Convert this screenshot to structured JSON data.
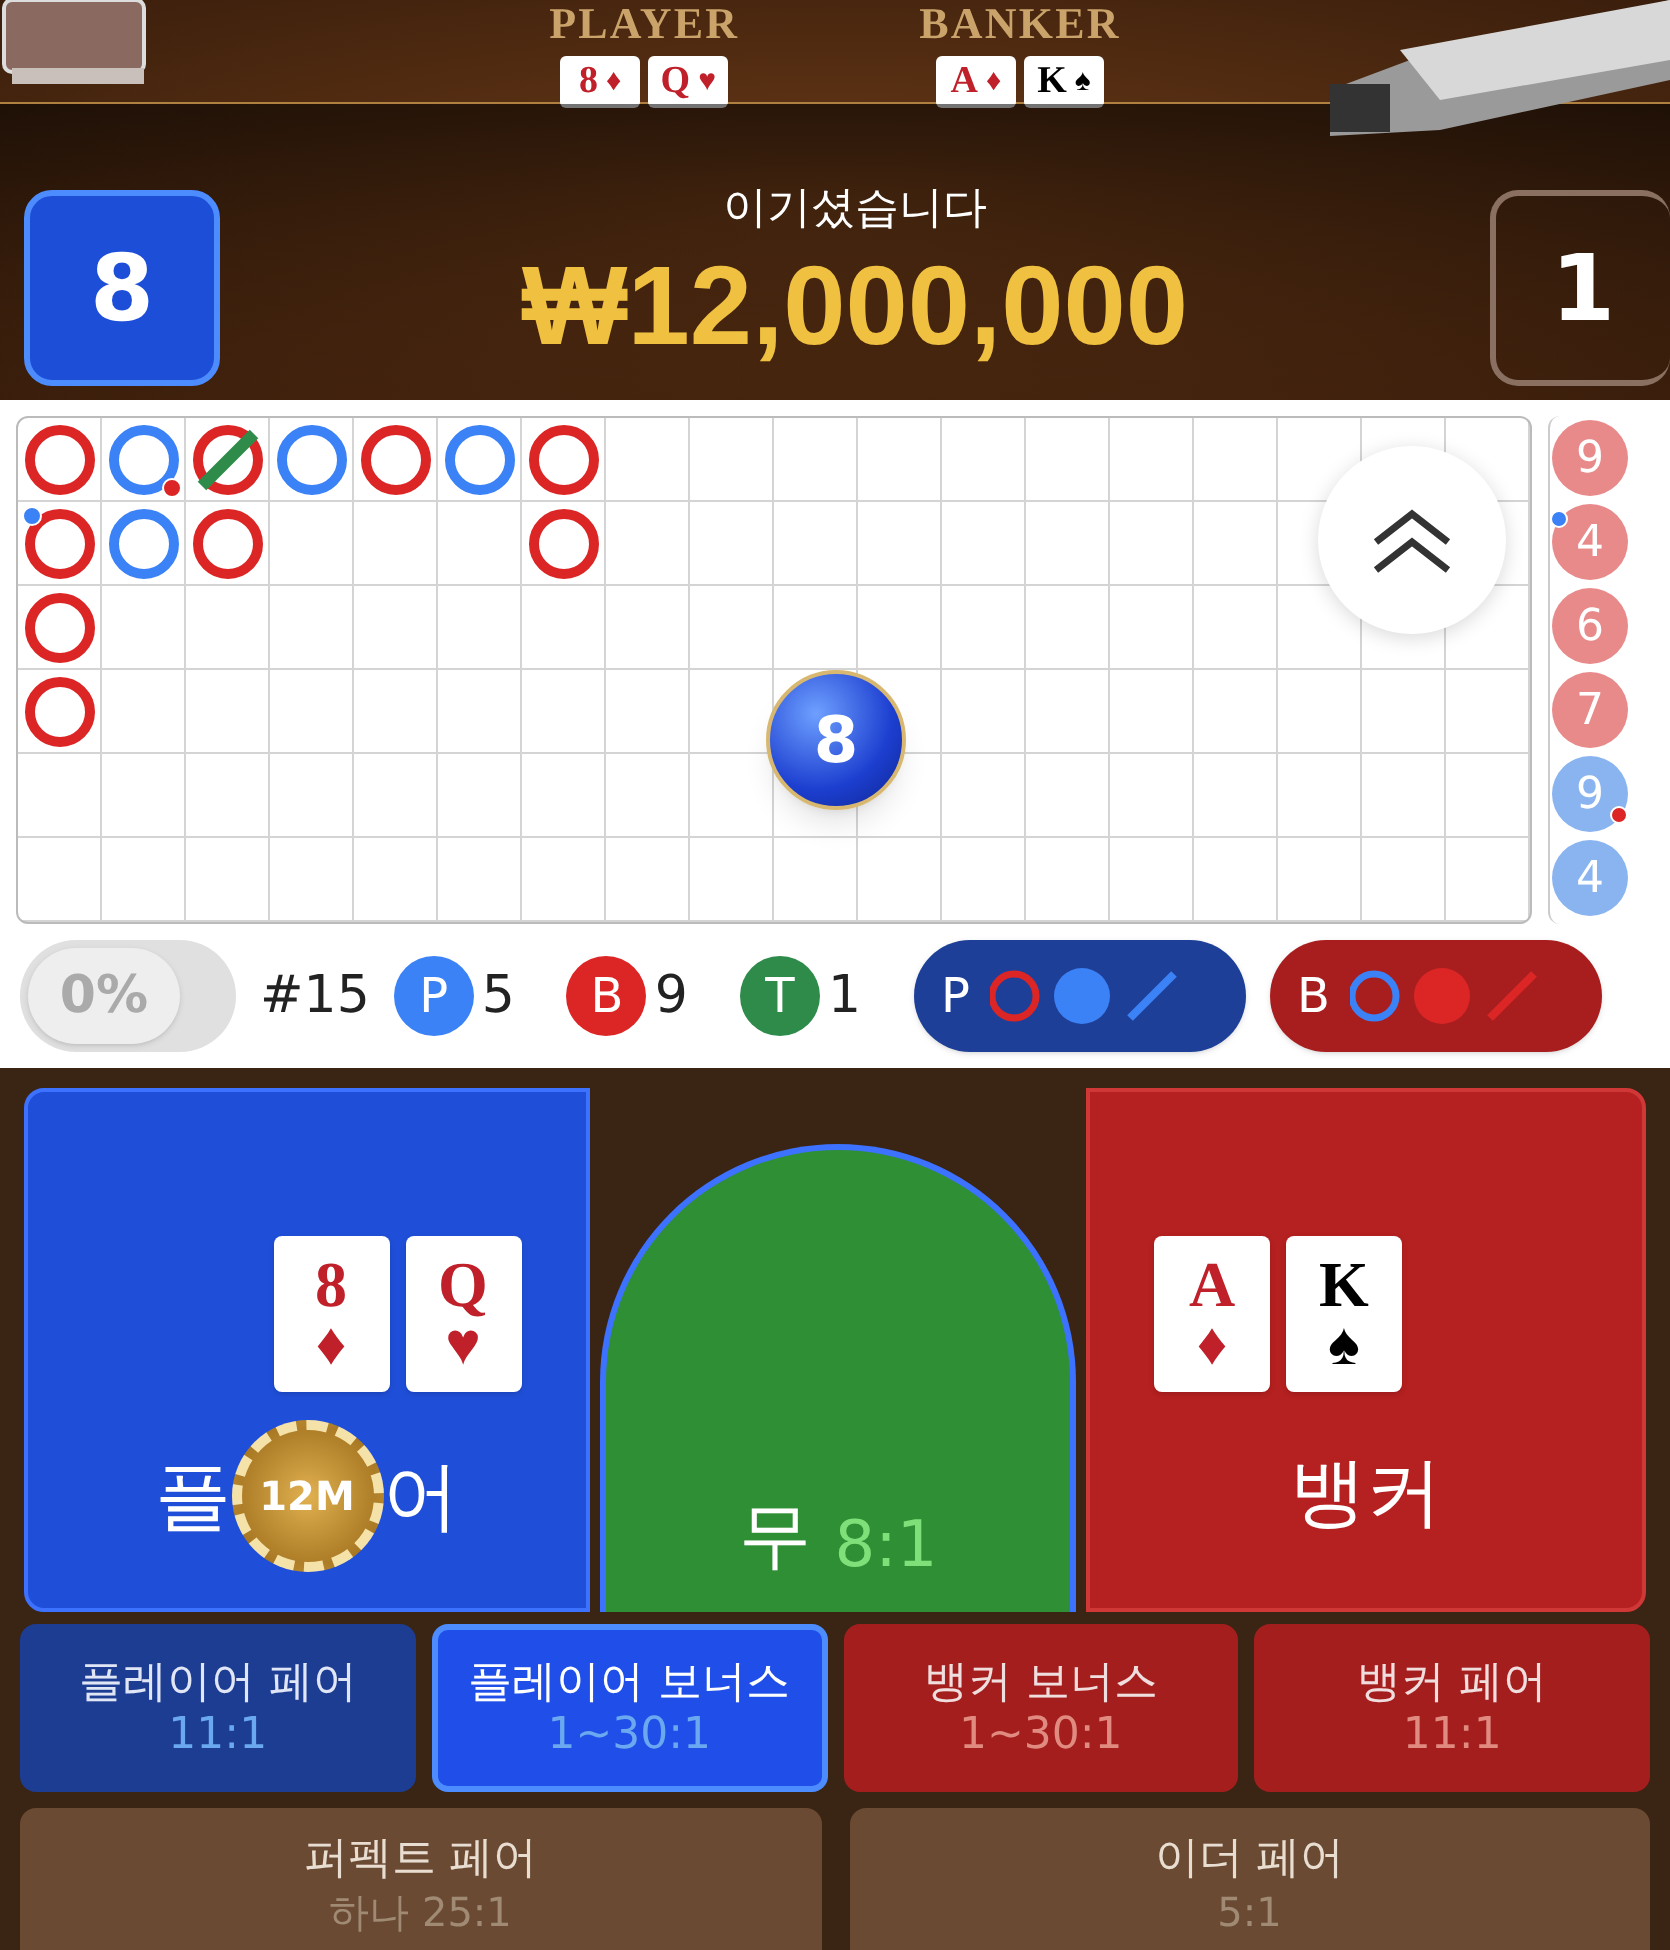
{
  "table_header": {
    "player_label": "PLAYER",
    "banker_label": "BANKER",
    "player_cards": [
      {
        "rank": "8",
        "suit": "♦",
        "red": true
      },
      {
        "rank": "Q",
        "suit": "♥",
        "red": true
      }
    ],
    "banker_cards": [
      {
        "rank": "A",
        "suit": "♦",
        "red": true
      },
      {
        "rank": "K",
        "suit": "♠",
        "red": false
      }
    ]
  },
  "result": {
    "player_score": "8",
    "player_won": true,
    "message": "이기셨습니다",
    "amount": "₩12,000,000",
    "banker_score": "1"
  },
  "road": {
    "columns": [
      [
        {
          "kind": "banker",
          "tie": false,
          "player_pair": false,
          "banker_pair": false
        },
        {
          "kind": "banker",
          "tie": false,
          "player_pair": true,
          "banker_pair": false
        },
        {
          "kind": "banker",
          "tie": false,
          "player_pair": false,
          "banker_pair": false
        },
        {
          "kind": "banker",
          "tie": false,
          "player_pair": false,
          "banker_pair": false
        }
      ],
      [
        {
          "kind": "player",
          "tie": false,
          "player_pair": false,
          "banker_pair": true
        },
        {
          "kind": "player",
          "tie": false,
          "player_pair": false,
          "banker_pair": false
        }
      ],
      [
        {
          "kind": "banker",
          "tie": true,
          "player_pair": false,
          "banker_pair": false
        },
        {
          "kind": "banker",
          "tie": false,
          "player_pair": false,
          "banker_pair": false
        }
      ],
      [
        {
          "kind": "player",
          "tie": false,
          "player_pair": false,
          "banker_pair": false
        }
      ],
      [
        {
          "kind": "banker",
          "tie": false,
          "player_pair": false,
          "banker_pair": false
        }
      ],
      [
        {
          "kind": "player",
          "tie": false,
          "player_pair": false,
          "banker_pair": false
        }
      ],
      [
        {
          "kind": "banker",
          "tie": false,
          "player_pair": false,
          "banker_pair": false
        },
        {
          "kind": "banker",
          "tie": false,
          "player_pair": false,
          "banker_pair": false
        }
      ]
    ],
    "last_result": "8",
    "bead_column": [
      {
        "number": "9",
        "kind": "banker",
        "player_pair": false,
        "banker_pair": false
      },
      {
        "number": "4",
        "kind": "banker",
        "player_pair": true,
        "banker_pair": false
      },
      {
        "number": "6",
        "kind": "banker",
        "player_pair": false,
        "banker_pair": false
      },
      {
        "number": "7",
        "kind": "banker",
        "player_pair": false,
        "banker_pair": false
      },
      {
        "number": "9",
        "kind": "player",
        "player_pair": false,
        "banker_pair": true
      },
      {
        "number": "4",
        "kind": "player",
        "player_pair": false,
        "banker_pair": false
      }
    ]
  },
  "stats": {
    "toggle": {
      "label": "0%",
      "on": false
    },
    "shoe": "#15",
    "counts": [
      {
        "letter": "P",
        "count": "5",
        "color": "#3b82f6"
      },
      {
        "letter": "B",
        "count": "9",
        "color": "#dc2626"
      },
      {
        "letter": "T",
        "count": "1",
        "color": "#2e8b4a"
      }
    ],
    "predict_buttons": [
      {
        "letter": "P",
        "kind": "player"
      },
      {
        "letter": "B",
        "kind": "banker"
      }
    ]
  },
  "bet_areas": {
    "player": {
      "label_start": "플",
      "label_end": "어",
      "cards": [
        {
          "rank": "8",
          "suit": "♦",
          "red": true
        },
        {
          "rank": "Q",
          "suit": "♥",
          "red": true
        }
      ],
      "chip": "12M"
    },
    "tie": {
      "label": "무",
      "odds": "8:1"
    },
    "banker": {
      "label": "뱅커",
      "cards": [
        {
          "rank": "A",
          "suit": "♦",
          "red": true
        },
        {
          "rank": "K",
          "suit": "♠",
          "red": false
        }
      ]
    }
  },
  "side_bets": [
    {
      "label": "플레이어 페어",
      "odds": "11:1",
      "kind": "player",
      "selected": false
    },
    {
      "label": "플레이어 보너스",
      "odds": "1~30:1",
      "kind": "player",
      "selected": true
    },
    {
      "label": "뱅커 보너스",
      "odds": "1~30:1",
      "kind": "banker",
      "selected": false
    },
    {
      "label": "뱅커 페어",
      "odds": "11:1",
      "kind": "banker",
      "selected": false
    }
  ],
  "extra_bets": [
    {
      "label": "퍼펙트 페어",
      "odds": "하나 25:1"
    },
    {
      "label": "이더 페어",
      "odds": "5:1"
    }
  ]
}
